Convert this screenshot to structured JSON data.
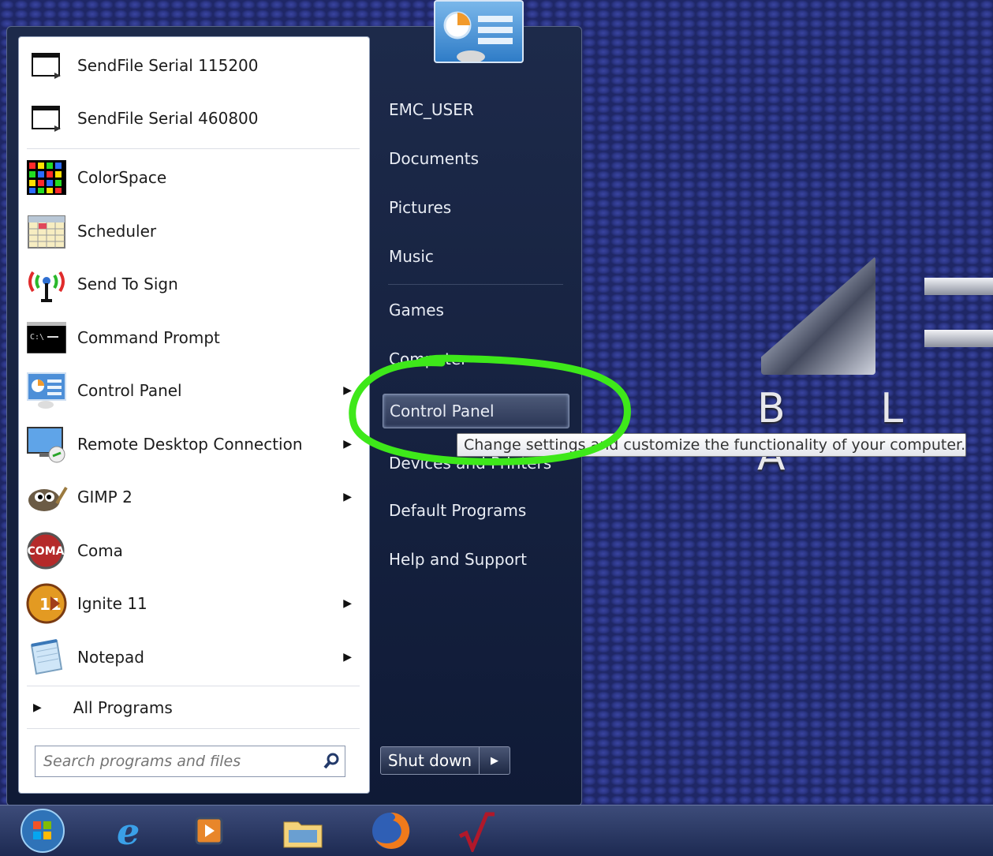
{
  "wallpaper": {
    "logo_text": "B L A"
  },
  "start_menu": {
    "programs": [
      {
        "label": "SendFile Serial 115200",
        "icon": "window-icon",
        "has_arrow": false
      },
      {
        "label": "SendFile Serial 460800",
        "icon": "window-icon",
        "has_arrow": false
      },
      {
        "label": "ColorSpace",
        "icon": "color-grid-icon",
        "has_arrow": false
      },
      {
        "label": "Scheduler",
        "icon": "calendar-icon",
        "has_arrow": false
      },
      {
        "label": "Send To Sign",
        "icon": "antenna-icon",
        "has_arrow": false
      },
      {
        "label": "Command Prompt",
        "icon": "terminal-icon",
        "has_arrow": false
      },
      {
        "label": "Control Panel",
        "icon": "control-panel-icon",
        "has_arrow": true
      },
      {
        "label": "Remote Desktop Connection",
        "icon": "remote-desktop-icon",
        "has_arrow": true
      },
      {
        "label": "GIMP 2",
        "icon": "gimp-icon",
        "has_arrow": true
      },
      {
        "label": "Coma",
        "icon": "coma-icon",
        "has_arrow": false
      },
      {
        "label": "Ignite 11",
        "icon": "ignite-icon",
        "has_arrow": true
      },
      {
        "label": "Notepad",
        "icon": "notepad-icon",
        "has_arrow": true
      }
    ],
    "all_programs": "All Programs",
    "search_placeholder": "Search programs and files",
    "right_items": {
      "user": "EMC_USER",
      "documents": "Documents",
      "pictures": "Pictures",
      "music": "Music",
      "games": "Games",
      "computer": "Computer",
      "control_panel": "Control Panel",
      "devices": "Devices and Printers",
      "default_programs": "Default Programs",
      "help": "Help and Support"
    },
    "shutdown": "Shut down",
    "tooltip": "Change settings and customize the functionality of your computer."
  },
  "colors": {
    "highlight": "#4d5a78",
    "annotation": "#3ee81a"
  }
}
